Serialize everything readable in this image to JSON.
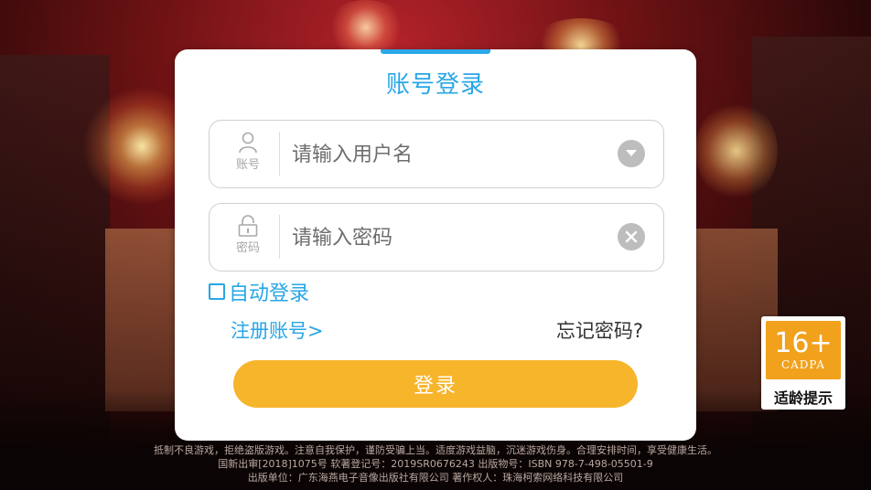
{
  "login_card": {
    "title": "账号登录",
    "username_field": {
      "icon_label": "账号",
      "placeholder": "请输入用户名",
      "value": "",
      "icon": "user-icon",
      "action_icon": "dropdown-icon"
    },
    "password_field": {
      "icon_label": "密码",
      "placeholder": "请输入密码",
      "value": "",
      "icon": "lock-icon",
      "action_icon": "clear-icon"
    },
    "auto_login_label": "自动登录",
    "auto_login_checked": false,
    "register_link": "注册账号>",
    "forgot_link": "忘记密码?",
    "login_button": "登录"
  },
  "age_rating": {
    "age": "16+",
    "org": "CADPA",
    "text": "适龄提示"
  },
  "footer": {
    "line1": "抵制不良游戏，拒绝盗版游戏。注意自我保护，谨防受骗上当。适度游戏益脑，沉迷游戏伤身。合理安排时间，享受健康生活。",
    "line2": "国新出审[2018]1075号  软著登记号：2019SR0676243  出版物号：ISBN 978-7-498-05501-9",
    "line3": "出版单位：广东海燕电子音像出版社有限公司    著作权人：珠海柯索网络科技有限公司"
  },
  "colors": {
    "accent": "#27a6e6",
    "login_button": "#f7b52c",
    "age_badge": "#f1a11c"
  }
}
